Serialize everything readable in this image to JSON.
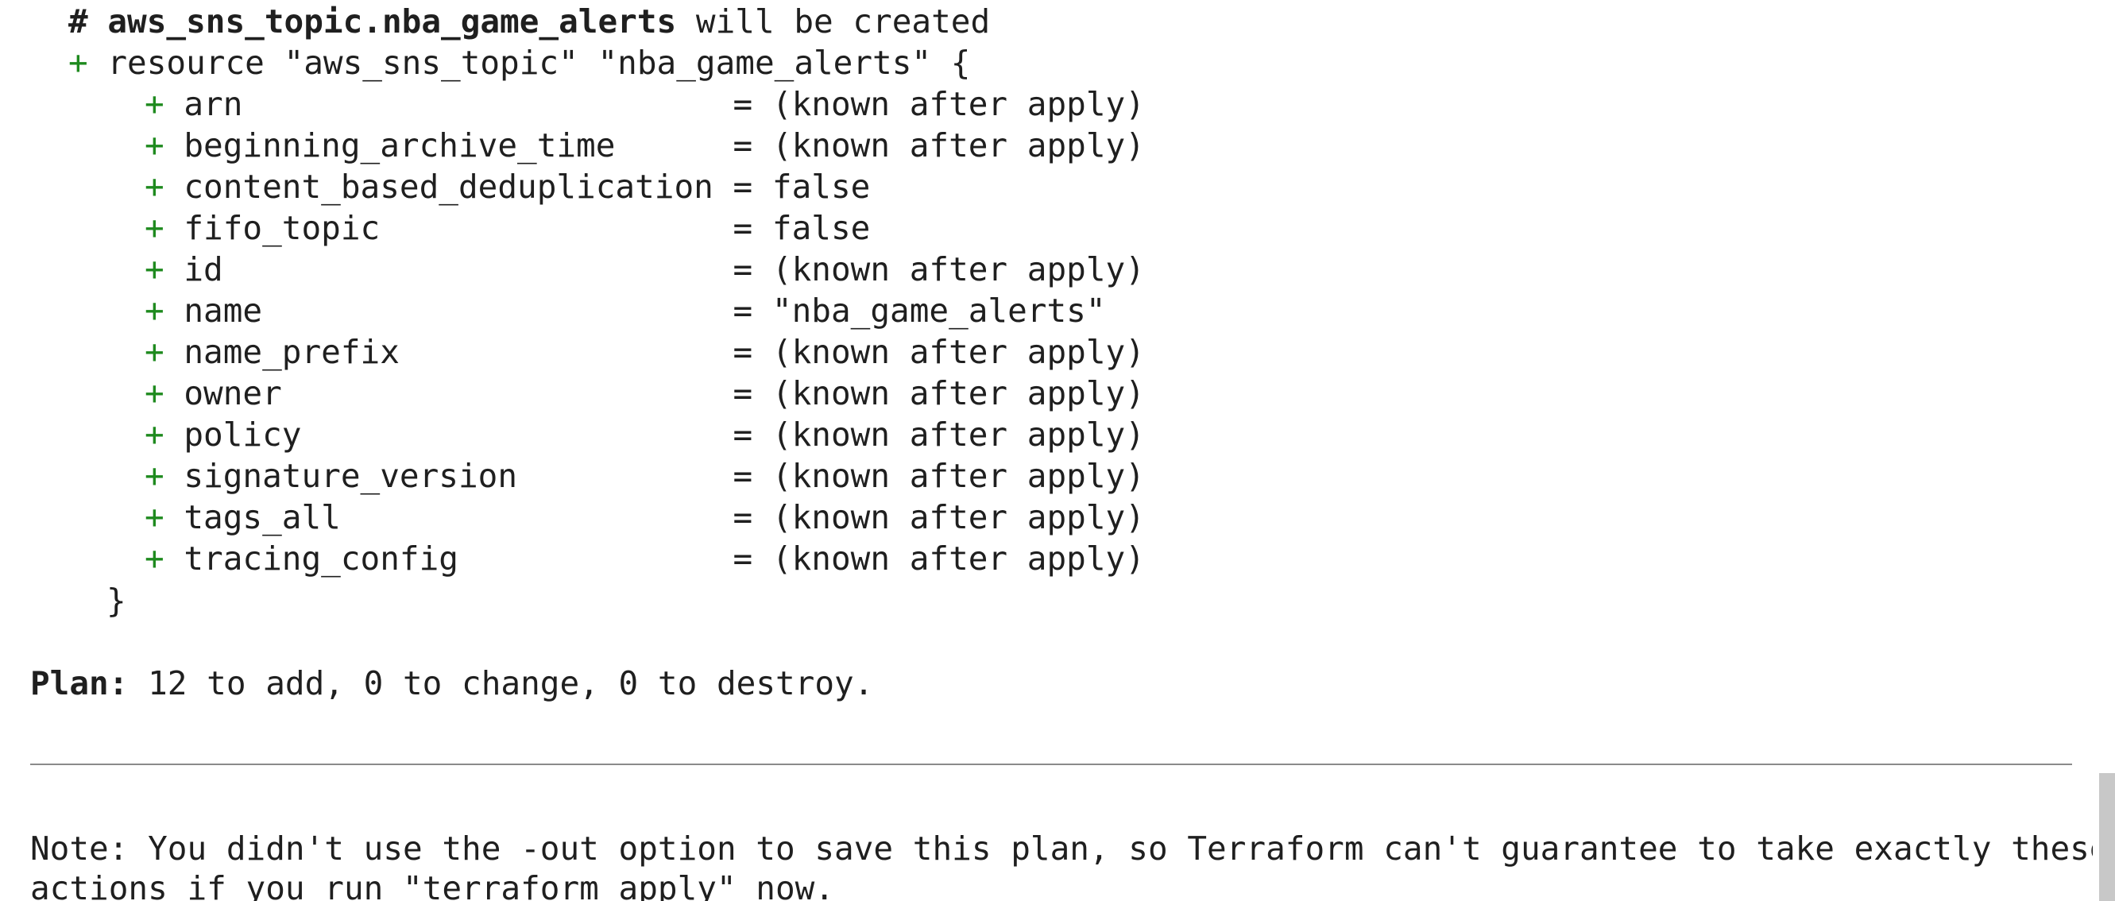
{
  "header": {
    "hash": "# ",
    "resource_address": "aws_sns_topic.nba_game_alerts",
    "action_text": " will be created"
  },
  "resource_line": {
    "plus": "+ ",
    "text": "resource \"aws_sns_topic\" \"nba_game_alerts\" {"
  },
  "attributes": [
    {
      "plus": "+ ",
      "name": "arn                         ",
      "eq": "= ",
      "value": "(known after apply)"
    },
    {
      "plus": "+ ",
      "name": "beginning_archive_time      ",
      "eq": "= ",
      "value": "(known after apply)"
    },
    {
      "plus": "+ ",
      "name": "content_based_deduplication ",
      "eq": "= ",
      "value": "false"
    },
    {
      "plus": "+ ",
      "name": "fifo_topic                  ",
      "eq": "= ",
      "value": "false"
    },
    {
      "plus": "+ ",
      "name": "id                          ",
      "eq": "= ",
      "value": "(known after apply)"
    },
    {
      "plus": "+ ",
      "name": "name                        ",
      "eq": "= ",
      "value": "\"nba_game_alerts\""
    },
    {
      "plus": "+ ",
      "name": "name_prefix                 ",
      "eq": "= ",
      "value": "(known after apply)"
    },
    {
      "plus": "+ ",
      "name": "owner                       ",
      "eq": "= ",
      "value": "(known after apply)"
    },
    {
      "plus": "+ ",
      "name": "policy                      ",
      "eq": "= ",
      "value": "(known after apply)"
    },
    {
      "plus": "+ ",
      "name": "signature_version           ",
      "eq": "= ",
      "value": "(known after apply)"
    },
    {
      "plus": "+ ",
      "name": "tags_all                    ",
      "eq": "= ",
      "value": "(known after apply)"
    },
    {
      "plus": "+ ",
      "name": "tracing_config              ",
      "eq": "= ",
      "value": "(known after apply)"
    }
  ],
  "closing_brace": "}",
  "plan": {
    "label": "Plan:",
    "summary": " 12 to add, 0 to change, 0 to destroy."
  },
  "note": {
    "line1": "Note: You didn't use the -out option to save this plan, so Terraform can't guarantee to take exactly these",
    "line2": "actions if you run \"terraform apply\" now."
  },
  "colors": {
    "plus": "#1e8a1e",
    "text": "#1f1f1f",
    "background": "#ffffff",
    "divider": "#8a8a8a"
  }
}
